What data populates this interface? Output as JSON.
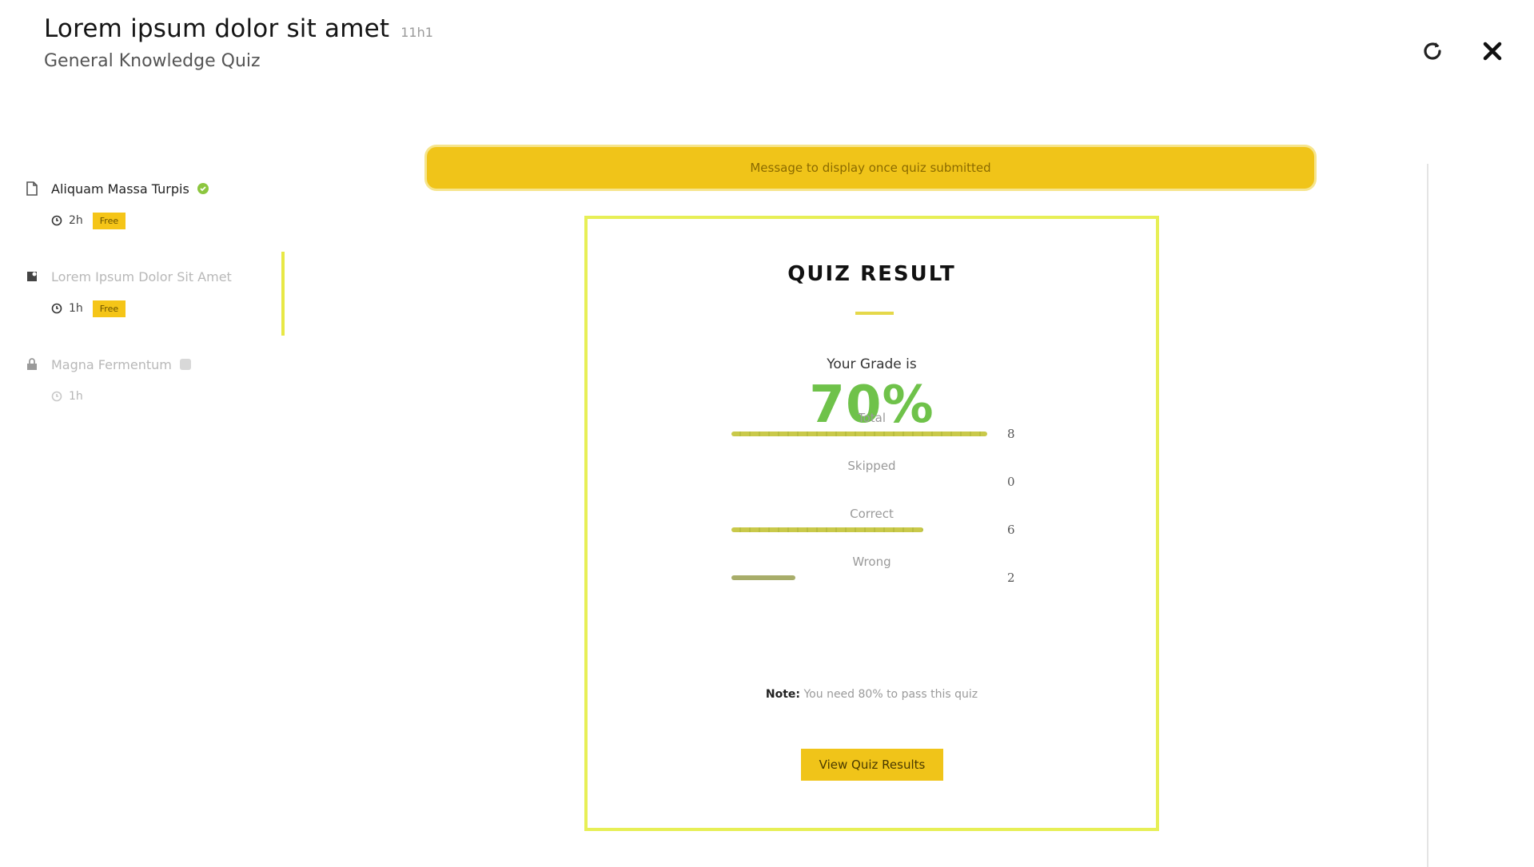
{
  "header": {
    "course_title": "Lorem ipsum dolor sit amet",
    "course_duration": "11h1",
    "quiz_name": "General Knowledge Quiz"
  },
  "icons": {
    "reload": "reload-icon",
    "close": "close-icon",
    "document": "document-icon",
    "clock": "clock-icon",
    "check": "check-icon"
  },
  "sidebar": {
    "lessons": [
      {
        "title": "Aliquam Massa Turpis",
        "duration": "2h",
        "badge": "Free",
        "state": "completed"
      },
      {
        "title": "Lorem Ipsum Dolor Sit Amet",
        "duration": "1h",
        "badge": "Free",
        "state": "active"
      },
      {
        "title": "Magna Fermentum",
        "duration": "1h",
        "badge": "",
        "state": "locked"
      }
    ]
  },
  "banner": {
    "message": "Message to display once quiz submitted"
  },
  "result": {
    "title": "QUIZ RESULT",
    "grade_label": "Your Grade is",
    "grade_value": "70%",
    "stats": [
      {
        "label": "Total",
        "value": "8",
        "fill": 1.0
      },
      {
        "label": "Skipped",
        "value": "0",
        "fill": 0.0
      },
      {
        "label": "Correct",
        "value": "6",
        "fill": 0.75
      },
      {
        "label": "Wrong",
        "value": "2",
        "fill": 0.25
      }
    ],
    "note_label": "Note:",
    "note_text": "You need 80% to pass this quiz",
    "view_button": "View Quiz Results"
  },
  "colors": {
    "accent_yellow": "#f0c419",
    "card_border": "#e7ef56",
    "grade_green": "#6fc24a",
    "complete_green": "#8cc63f"
  }
}
